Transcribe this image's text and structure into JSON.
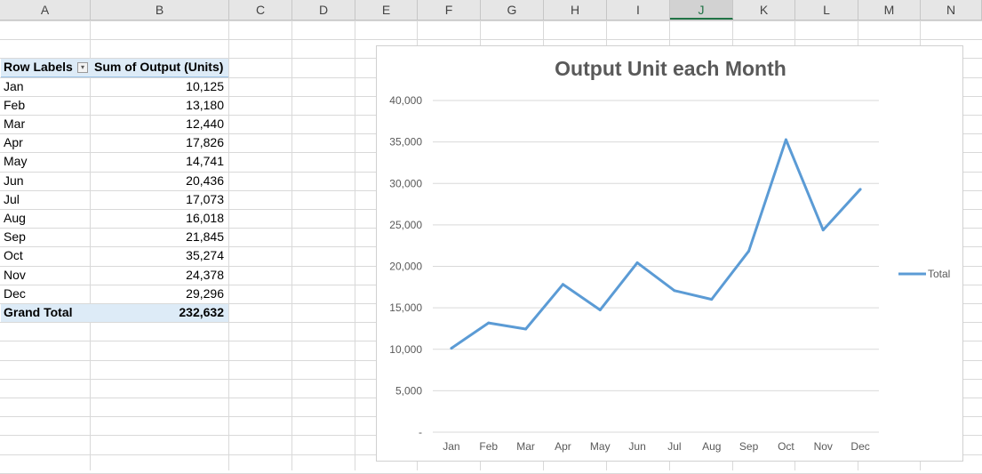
{
  "columns": [
    "A",
    "B",
    "C",
    "D",
    "E",
    "F",
    "G",
    "H",
    "I",
    "J",
    "K",
    "L",
    "M",
    "N"
  ],
  "selected_column": "J",
  "pivot": {
    "header_label": "Row Labels",
    "header_value": "Sum of Output (Units)",
    "rows": [
      {
        "label": "Jan",
        "value": "10,125"
      },
      {
        "label": "Feb",
        "value": "13,180"
      },
      {
        "label": "Mar",
        "value": "12,440"
      },
      {
        "label": "Apr",
        "value": "17,826"
      },
      {
        "label": "May",
        "value": "14,741"
      },
      {
        "label": "Jun",
        "value": "20,436"
      },
      {
        "label": "Jul",
        "value": "17,073"
      },
      {
        "label": "Aug",
        "value": "16,018"
      },
      {
        "label": "Sep",
        "value": "21,845"
      },
      {
        "label": "Oct",
        "value": "35,274"
      },
      {
        "label": "Nov",
        "value": "24,378"
      },
      {
        "label": "Dec",
        "value": "29,296"
      }
    ],
    "total_label": "Grand Total",
    "total_value": "232,632"
  },
  "chart_data": {
    "type": "line",
    "title": "Output Unit each Month",
    "categories": [
      "Jan",
      "Feb",
      "Mar",
      "Apr",
      "May",
      "Jun",
      "Jul",
      "Aug",
      "Sep",
      "Oct",
      "Nov",
      "Dec"
    ],
    "series": [
      {
        "name": "Total",
        "color": "#5b9bd5",
        "values": [
          10125,
          13180,
          12440,
          17826,
          14741,
          20436,
          17073,
          16018,
          21845,
          35274,
          24378,
          29296
        ]
      }
    ],
    "ylim": [
      0,
      40000
    ],
    "yticks": [
      0,
      5000,
      10000,
      15000,
      20000,
      25000,
      30000,
      35000,
      40000
    ],
    "ytick_labels": [
      "-",
      "5,000",
      "10,000",
      "15,000",
      "20,000",
      "25,000",
      "30,000",
      "35,000",
      "40,000"
    ],
    "grid": true,
    "legend": "right"
  }
}
